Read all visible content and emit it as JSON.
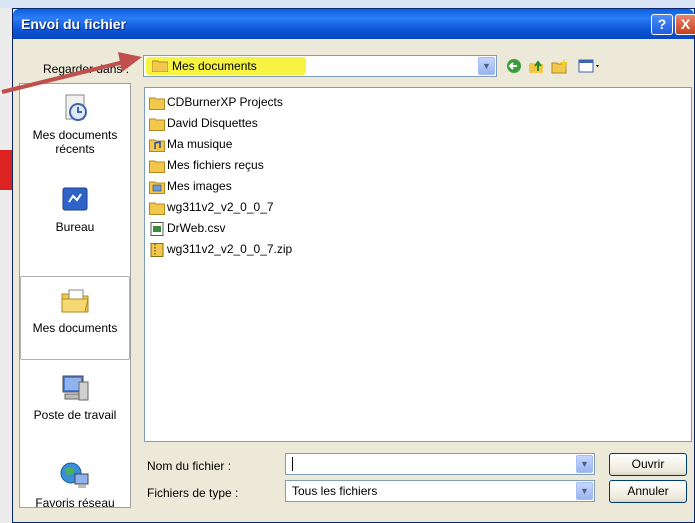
{
  "dialog": {
    "title": "Envoi du fichier",
    "help_button": "?",
    "close_button": "X"
  },
  "look_in": {
    "label": "Regarder dans :",
    "value": "Mes documents"
  },
  "toolbar": {
    "back_icon": "back-arrow-icon",
    "up_icon": "up-folder-icon",
    "new_folder_icon": "new-folder-icon",
    "view_icon": "view-menu-icon"
  },
  "places": [
    {
      "label": "Mes documents récents",
      "icon": "recent-documents-icon"
    },
    {
      "label": "Bureau",
      "icon": "desktop-icon"
    },
    {
      "label": "Mes documents",
      "icon": "my-documents-icon"
    },
    {
      "label": "Poste de travail",
      "icon": "my-computer-icon"
    },
    {
      "label": "Favoris réseau",
      "icon": "network-places-icon"
    }
  ],
  "files": [
    {
      "name": "CDBurnerXP Projects",
      "icon": "folder"
    },
    {
      "name": "David Disquettes",
      "icon": "folder"
    },
    {
      "name": "Ma musique",
      "icon": "music-folder"
    },
    {
      "name": "Mes fichiers reçus",
      "icon": "folder"
    },
    {
      "name": "Mes images",
      "icon": "pictures-folder"
    },
    {
      "name": "wg311v2_v2_0_0_7",
      "icon": "folder"
    },
    {
      "name": "DrWeb.csv",
      "icon": "csv-file"
    },
    {
      "name": "wg311v2_v2_0_0_7.zip",
      "icon": "zip-file"
    }
  ],
  "filename": {
    "label": "Nom du fichier :",
    "value": ""
  },
  "filetype": {
    "label": "Fichiers de type :",
    "value": "Tous les fichiers"
  },
  "buttons": {
    "open": "Ouvrir",
    "cancel": "Annuler"
  },
  "colors": {
    "titlebar": "#0a5fe0",
    "highlight": "#f6f342",
    "annotation_arrow": "#c0504d"
  }
}
